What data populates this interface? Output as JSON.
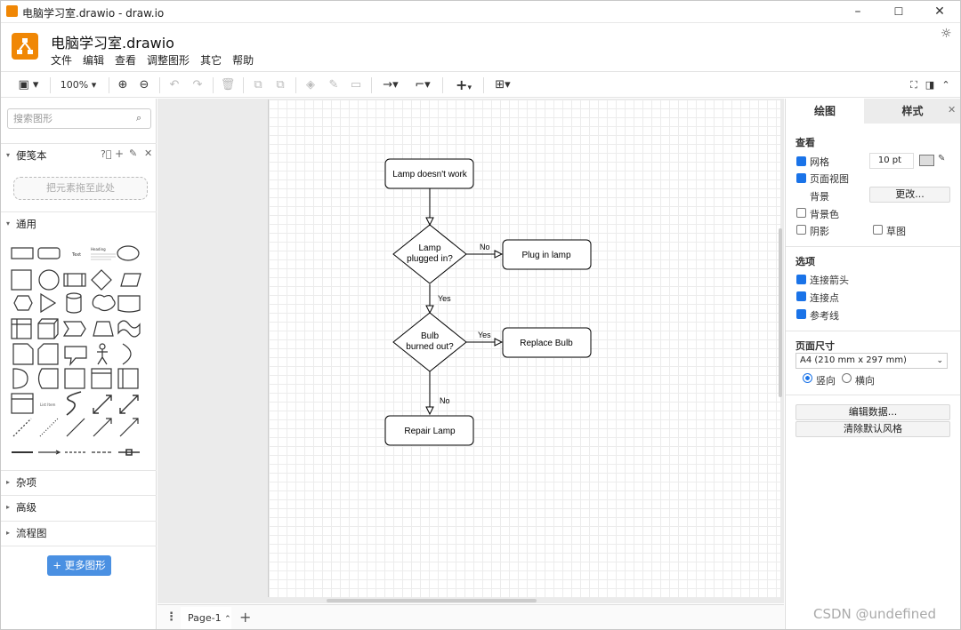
{
  "window": {
    "title": "电脑学习室.drawio - draw.io"
  },
  "header": {
    "file_title": "电脑学习室.drawio",
    "menu": [
      "文件",
      "编辑",
      "查看",
      "调整图形",
      "其它",
      "帮助"
    ]
  },
  "toolbar": {
    "zoom": "100%"
  },
  "left": {
    "search_placeholder": "搜索图形",
    "scratchpad": "便笺本",
    "dropzone": "把元素拖至此处",
    "general": "通用",
    "shape_text": "Text",
    "shape_heading": "Heading",
    "shape_listitem": "List Item",
    "sections": [
      "杂项",
      "高级",
      "流程图"
    ],
    "more_shapes": "更多图形"
  },
  "diagram": {
    "nodes": {
      "start": "Lamp doesn't work",
      "q1a": "Lamp",
      "q1b": "plugged in?",
      "plug": "Plug in lamp",
      "q2a": "Bulb",
      "q2b": "burned out?",
      "replace": "Replace Bulb",
      "repair": "Repair Lamp"
    },
    "edges": {
      "e1": "No",
      "e2": "Yes",
      "e3": "Yes",
      "e4": "No"
    }
  },
  "bottom": {
    "page_tab": "Page-1"
  },
  "right": {
    "tabs": [
      "绘图",
      "样式"
    ],
    "view_header": "查看",
    "grid": "网格",
    "grid_size": "10 pt",
    "page_view": "页面视图",
    "background": "背景",
    "change": "更改...",
    "bg_color": "背景色",
    "shadow": "阴影",
    "sketch": "草图",
    "options_header": "选项",
    "connect_arrows": "连接箭头",
    "connect_points": "连接点",
    "guides": "参考线",
    "page_size_header": "页面尺寸",
    "page_size": "A4 (210 mm x 297 mm)",
    "portrait": "竖向",
    "landscape": "横向",
    "edit_data": "编辑数据...",
    "clear_style": "清除默认风格"
  },
  "watermark": "CSDN @undefined"
}
